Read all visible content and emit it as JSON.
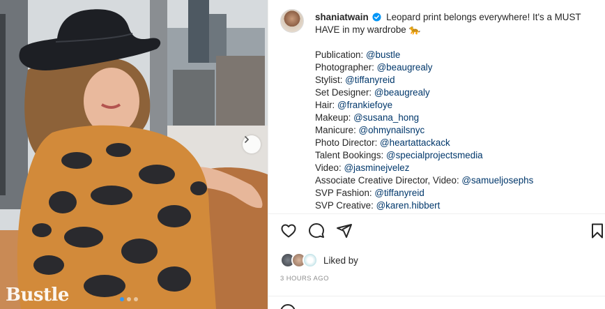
{
  "photo": {
    "watermark": "Bustle",
    "next_icon": "chevron-right-icon",
    "carousel": {
      "count": 3,
      "active_index": 0
    }
  },
  "post": {
    "username": "shaniatwain",
    "verified_icon": "verified-badge-icon",
    "caption_lines": [
      "Leopard print belongs everywhere! It's a MUST",
      "HAVE in my wardrobe 🐆"
    ],
    "credits": [
      {
        "label": "Publication: ",
        "handle": "@bustle"
      },
      {
        "label": "Photographer: ",
        "handle": "@beaugrealy"
      },
      {
        "label": "Stylist: ",
        "handle": "@tiffanyreid"
      },
      {
        "label": "Set Designer: ",
        "handle": "@beaugrealy"
      },
      {
        "label": "Hair: ",
        "handle": "@frankiefoye"
      },
      {
        "label": "Makeup: ",
        "handle": "@susana_hong"
      },
      {
        "label": "Manicure: ",
        "handle": "@ohmynailsnyc"
      },
      {
        "label": "Photo Director: ",
        "handle": "@heartattackack"
      },
      {
        "label": "Talent Bookings: ",
        "handle": "@specialprojectsmedia"
      },
      {
        "label": "Video: ",
        "handle": "@jasminejvelez"
      },
      {
        "label": "Associate Creative Director, Video: ",
        "handle": "@samueljosephs"
      },
      {
        "label": "SVP Fashion: ",
        "handle": "@tiffanyreid"
      },
      {
        "label": "SVP Creative: ",
        "handle": "@karen.hibbert"
      }
    ],
    "liked_by_text": "Liked by",
    "timestamp": "3 HOURS AGO"
  },
  "actions": {
    "like_icon": "heart-icon",
    "comment_icon": "comment-icon",
    "share_icon": "share-icon",
    "save_icon": "bookmark-icon"
  },
  "colors": {
    "text": "#262626",
    "link": "#00376b",
    "muted": "#8e8e8e",
    "verified": "#0095f6",
    "active_dot": "#3897f0"
  }
}
